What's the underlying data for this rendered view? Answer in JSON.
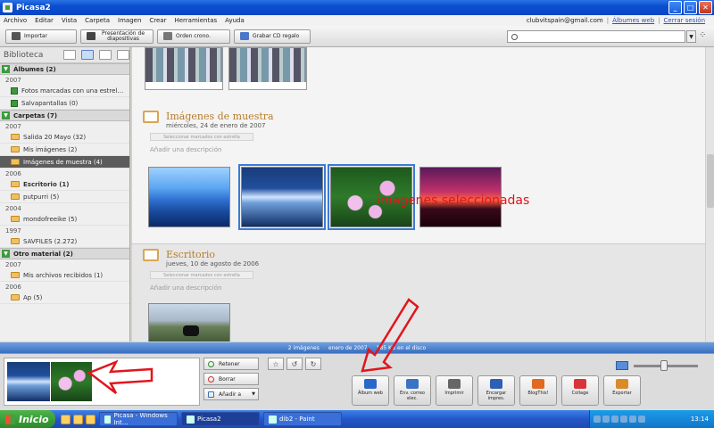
{
  "window": {
    "title": "Picasa2"
  },
  "menu": [
    "Archivo",
    "Editar",
    "Vista",
    "Carpeta",
    "Imagen",
    "Crear",
    "Herramientas",
    "Ayuda"
  ],
  "account": {
    "email": "clubvitspain@gmail.com",
    "web_album": "Álbumes web",
    "logout": "Cerrar sesión"
  },
  "toolbar": {
    "import": "Importar",
    "slideshow": "Presentación de diapositivas",
    "chrono": "Orden crono.",
    "burn": "Grabar CD regalo"
  },
  "sidebar": {
    "title": "Biblioteca",
    "sections": [
      {
        "label": "Álbumes (2)",
        "toggle": "▼",
        "years": [
          {
            "year": "2007",
            "items": [
              {
                "label": "Fotos marcadas con una estrel…"
              },
              {
                "label": "Salvapantallas (0)"
              }
            ]
          }
        ]
      },
      {
        "label": "Carpetas (7)",
        "toggle": "▼",
        "years": [
          {
            "year": "2007",
            "items": [
              {
                "label": "Salida 20 Mayo (32)"
              },
              {
                "label": "Mis imágenes (2)"
              },
              {
                "label": "Imágenes de muestra (4)",
                "selected": true
              }
            ]
          },
          {
            "year": "2006",
            "items": [
              {
                "label": "Escritorio (1)",
                "bold": true
              },
              {
                "label": "putpurri (5)"
              }
            ]
          },
          {
            "year": "2004",
            "items": [
              {
                "label": "mondofreeike (5)"
              }
            ]
          },
          {
            "year": "1997",
            "items": [
              {
                "label": "SAVFILES (2.272)"
              }
            ]
          }
        ]
      },
      {
        "label": "Otro material (2)",
        "toggle": "▼",
        "years": [
          {
            "year": "2007",
            "items": [
              {
                "label": "Mis archivos recibidos (1)"
              }
            ]
          },
          {
            "year": "2006",
            "items": [
              {
                "label": "Ap (5)"
              }
            ]
          }
        ]
      }
    ]
  },
  "albums": [
    {
      "name": "Imágenes de muestra",
      "date": "miércoles, 24 de enero de 2007",
      "select_bar": "Seleccionar marcados con estrella",
      "desc": "Añadir una descripción"
    },
    {
      "name": "Escritorio",
      "date": "jueves, 10 de agosto de 2006",
      "select_bar": "Seleccionar marcados con estrella",
      "desc": "Añadir una descripción"
    }
  ],
  "overlay_text": "imagenes seleccionadas",
  "status": {
    "count": "2 imágenes",
    "date": "enero de 2007",
    "size": "185 KB en el disco"
  },
  "tray": {
    "retain": "Retener",
    "delete": "Borrar",
    "add": "Añadir a",
    "buttons": [
      {
        "label": "Álbum web",
        "color": "#2a67c8"
      },
      {
        "label": "Env. correo elec.",
        "color": "#3a72c4"
      },
      {
        "label": "Imprimir",
        "color": "#666666"
      },
      {
        "label": "Encargar impres.",
        "color": "#2d5fb5"
      },
      {
        "label": "BlogThis!",
        "color": "#e06a20"
      },
      {
        "label": "Collage",
        "color": "#d8343a"
      },
      {
        "label": "Exportar",
        "color": "#d98b2a"
      }
    ]
  },
  "taskbar": {
    "start": "Inicio",
    "tasks": [
      {
        "label": "Picasa - Windows Int…"
      },
      {
        "label": "Picasa2",
        "active": true
      },
      {
        "label": "dib2 - Paint"
      }
    ],
    "clock": "13:14"
  },
  "colors": {
    "accent_red": "#e0161d",
    "title_blue": "#0846c4",
    "folder_orange": "#b87c28"
  }
}
